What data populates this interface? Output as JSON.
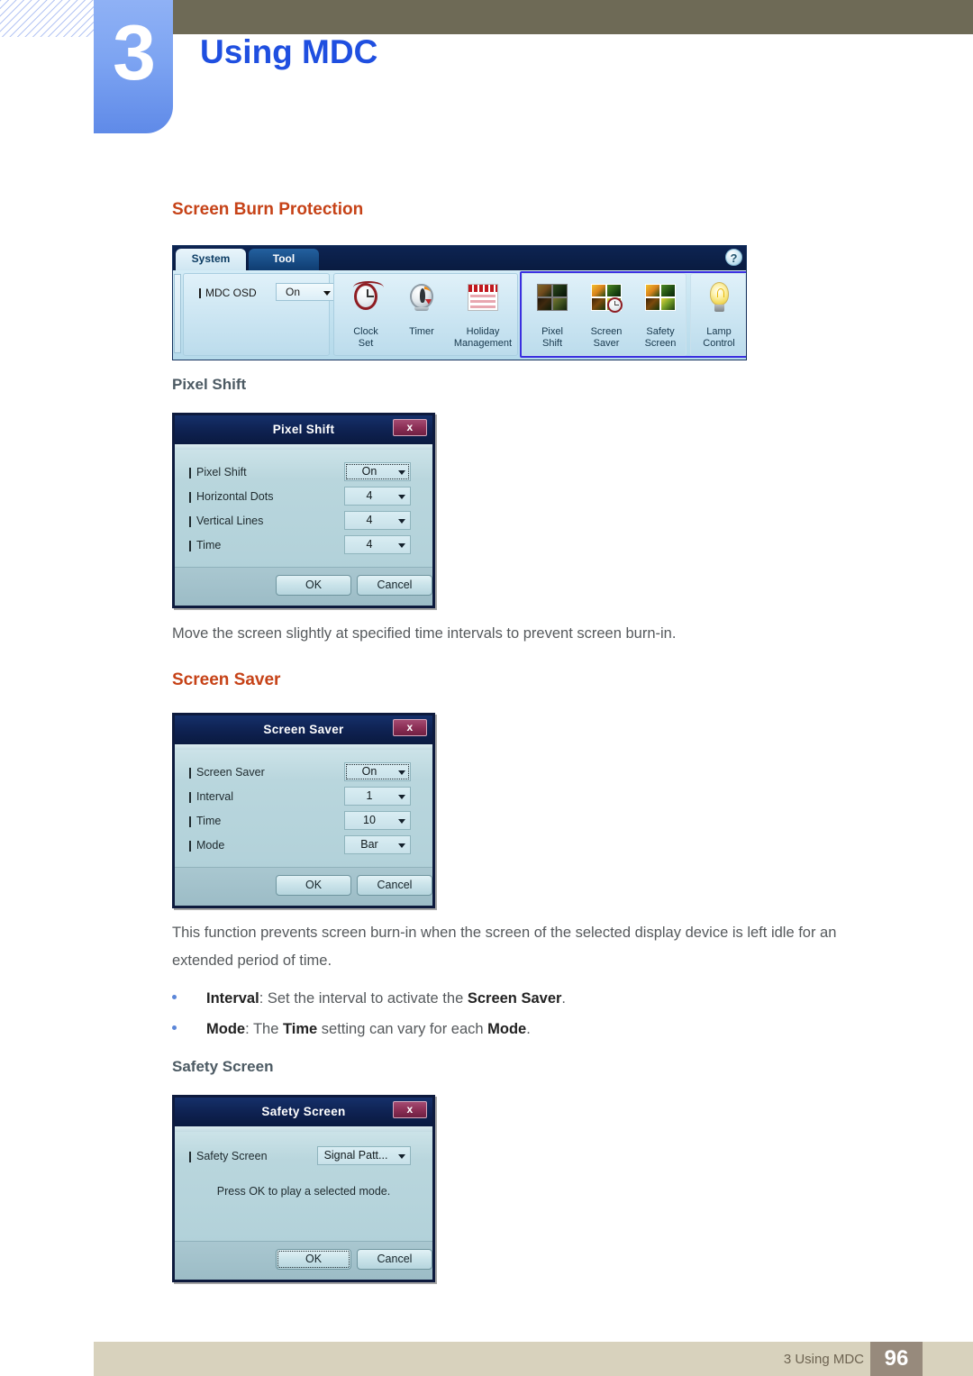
{
  "header": {
    "chapter_number": "3",
    "chapter_title": "Using MDC"
  },
  "sections": {
    "screen_burn_protection_heading": "Screen Burn Protection",
    "pixel_shift_heading": "Pixel Shift",
    "pixel_shift_desc": "Move the screen slightly at specified time intervals to prevent screen burn-in.",
    "screen_saver_heading": "Screen Saver",
    "screen_saver_desc_line1": "This function prevents screen burn-in when the screen of the selected display device is left idle for an",
    "screen_saver_desc_line2": "extended period of time.",
    "safety_screen_heading": "Safety Screen"
  },
  "bullets": [
    {
      "term": "Interval",
      "before": ": Set the interval to activate the ",
      "emphasis": "Screen Saver",
      "after": "."
    },
    {
      "term": "Mode",
      "before": ": The ",
      "emphasis": "Time",
      "middle": " setting can vary for each ",
      "emphasis2": "Mode",
      "after": "."
    }
  ],
  "mdc_toolbar": {
    "tabs": [
      {
        "label": "System",
        "selected": true
      },
      {
        "label": "Tool",
        "selected": false
      }
    ],
    "help_icon": "?",
    "osd": {
      "label": "MDC OSD",
      "value": "On"
    },
    "groups": [
      {
        "items": [
          {
            "label_line1": "Clock",
            "label_line2": "Set",
            "icon": "alarm-clock-icon"
          },
          {
            "label_line1": "Timer",
            "label_line2": "",
            "icon": "timer-icon"
          },
          {
            "label_line1": "Holiday",
            "label_line2": "Management",
            "icon": "calendar-icon"
          }
        ]
      },
      {
        "highlighted": true,
        "items": [
          {
            "label_line1": "Pixel",
            "label_line2": "Shift",
            "icon": "pixel-shift-icon"
          },
          {
            "label_line1": "Screen",
            "label_line2": "Saver",
            "icon": "screen-saver-icon"
          },
          {
            "label_line1": "Safety",
            "label_line2": "Screen",
            "icon": "safety-screen-icon"
          }
        ]
      },
      {
        "items": [
          {
            "label_line1": "Lamp",
            "label_line2": "Control",
            "icon": "lamp-icon"
          }
        ]
      }
    ]
  },
  "dialogs": {
    "pixel_shift": {
      "title": "Pixel Shift",
      "close_label": "x",
      "rows": [
        {
          "label": "Pixel Shift",
          "value": "On",
          "focused": true
        },
        {
          "label": "Horizontal Dots",
          "value": "4",
          "focused": false
        },
        {
          "label": "Vertical Lines",
          "value": "4",
          "focused": false
        },
        {
          "label": "Time",
          "value": "4",
          "focused": false
        }
      ],
      "ok_label": "OK",
      "cancel_label": "Cancel"
    },
    "screen_saver": {
      "title": "Screen Saver",
      "close_label": "x",
      "rows": [
        {
          "label": "Screen Saver",
          "value": "On",
          "focused": true
        },
        {
          "label": "Interval",
          "value": "1",
          "focused": false
        },
        {
          "label": "Time",
          "value": "10",
          "focused": false
        },
        {
          "label": "Mode",
          "value": "Bar",
          "focused": false
        }
      ],
      "ok_label": "OK",
      "cancel_label": "Cancel"
    },
    "safety_screen": {
      "title": "Safety Screen",
      "close_label": "x",
      "rows": [
        {
          "label": "Safety Screen",
          "value": "Signal Patt...",
          "focused": false
        }
      ],
      "message": "Press OK to play a selected mode.",
      "ok_label": "OK",
      "cancel_label": "Cancel"
    }
  },
  "footer": {
    "text": "3 Using MDC",
    "page_number": "96"
  },
  "colors": {
    "chapter_blue": "#1f4fe0",
    "heading_orange": "#c64217",
    "subheading_slate": "#4c5a63",
    "topbar_olive": "#6e6a56",
    "footer_beige": "#d8d2bd",
    "footer_page_brown": "#978a7c",
    "selection_ring": "#3a2fe0"
  }
}
